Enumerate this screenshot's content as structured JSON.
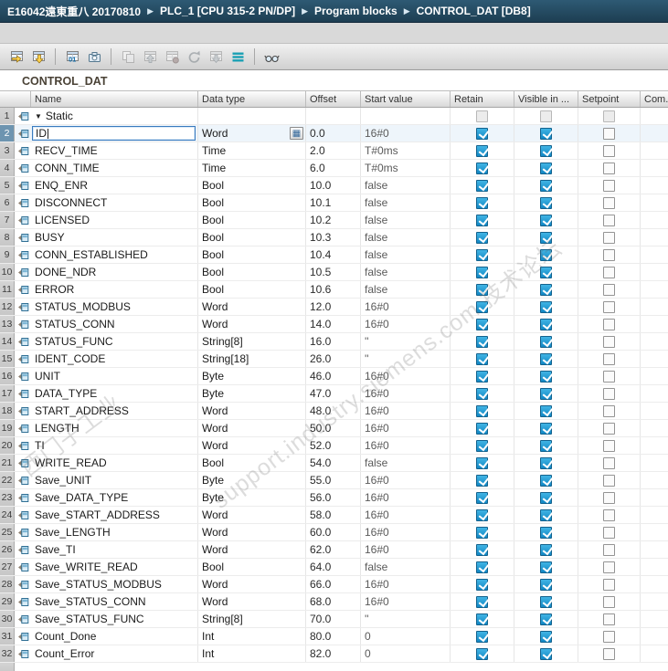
{
  "colors": {
    "titlebar": "#1d3e52",
    "checkbox_checked": "#1187c4",
    "selection": "#6d94b0",
    "toolbar_teal": "#19a0b4"
  },
  "breadcrumb": {
    "separator": "▶",
    "items": [
      "E16042遠東重八 20170810",
      "PLC_1 [CPU 315-2 PN/DP]",
      "Program blocks",
      "CONTROL_DAT [DB8]"
    ]
  },
  "toolbar": {
    "buttons": [
      {
        "name": "insert-row"
      },
      {
        "name": "add-row"
      },
      {
        "sep": true
      },
      {
        "name": "keep-actual-values"
      },
      {
        "name": "snapshot-actual-values"
      },
      {
        "sep": true
      },
      {
        "name": "copy-snapshots-to-start-values",
        "disabled": true
      },
      {
        "name": "load-start-values-as-actual",
        "disabled": true
      },
      {
        "name": "initialize-setpoints",
        "disabled": true
      },
      {
        "name": "update-interface",
        "disabled": true
      },
      {
        "name": "download-without-reinit",
        "disabled": true
      },
      {
        "name": "expanded-mode"
      },
      {
        "sep": true
      },
      {
        "name": "monitor-all"
      }
    ]
  },
  "title": "CONTROL_DAT",
  "icons": {
    "collapse": "▼",
    "datatype_picker": "▦"
  },
  "table": {
    "columns": [
      "Name",
      "Data type",
      "Offset",
      "Start value",
      "Retain",
      "Visible in ...",
      "Setpoint",
      "Com..."
    ],
    "rows": [
      {
        "num": "1",
        "kind": "section",
        "name": "Static"
      },
      {
        "num": "2",
        "name": "ID",
        "data_type": "Word",
        "offset": "0.0",
        "start_value": "16#0",
        "retain": true,
        "visible": true,
        "setpoint": false,
        "editing": true
      },
      {
        "num": "3",
        "name": "RECV_TIME",
        "data_type": "Time",
        "offset": "2.0",
        "start_value": "T#0ms",
        "retain": true,
        "visible": true,
        "setpoint": false
      },
      {
        "num": "4",
        "name": "CONN_TIME",
        "data_type": "Time",
        "offset": "6.0",
        "start_value": "T#0ms",
        "retain": true,
        "visible": true,
        "setpoint": false
      },
      {
        "num": "5",
        "name": "ENQ_ENR",
        "data_type": "Bool",
        "offset": "10.0",
        "start_value": "false",
        "retain": true,
        "visible": true,
        "setpoint": false
      },
      {
        "num": "6",
        "name": "DISCONNECT",
        "data_type": "Bool",
        "offset": "10.1",
        "start_value": "false",
        "retain": true,
        "visible": true,
        "setpoint": false
      },
      {
        "num": "7",
        "name": "LICENSED",
        "data_type": "Bool",
        "offset": "10.2",
        "start_value": "false",
        "retain": true,
        "visible": true,
        "setpoint": false
      },
      {
        "num": "8",
        "name": "BUSY",
        "data_type": "Bool",
        "offset": "10.3",
        "start_value": "false",
        "retain": true,
        "visible": true,
        "setpoint": false
      },
      {
        "num": "9",
        "name": "CONN_ESTABLISHED",
        "data_type": "Bool",
        "offset": "10.4",
        "start_value": "false",
        "retain": true,
        "visible": true,
        "setpoint": false
      },
      {
        "num": "10",
        "name": "DONE_NDR",
        "data_type": "Bool",
        "offset": "10.5",
        "start_value": "false",
        "retain": true,
        "visible": true,
        "setpoint": false
      },
      {
        "num": "11",
        "name": "ERROR",
        "data_type": "Bool",
        "offset": "10.6",
        "start_value": "false",
        "retain": true,
        "visible": true,
        "setpoint": false
      },
      {
        "num": "12",
        "name": "STATUS_MODBUS",
        "data_type": "Word",
        "offset": "12.0",
        "start_value": "16#0",
        "retain": true,
        "visible": true,
        "setpoint": false
      },
      {
        "num": "13",
        "name": "STATUS_CONN",
        "data_type": "Word",
        "offset": "14.0",
        "start_value": "16#0",
        "retain": true,
        "visible": true,
        "setpoint": false
      },
      {
        "num": "14",
        "name": "STATUS_FUNC",
        "data_type": "String[8]",
        "offset": "16.0",
        "start_value": "''",
        "retain": true,
        "visible": true,
        "setpoint": false
      },
      {
        "num": "15",
        "name": "IDENT_CODE",
        "data_type": "String[18]",
        "offset": "26.0",
        "start_value": "''",
        "retain": true,
        "visible": true,
        "setpoint": false
      },
      {
        "num": "16",
        "name": "UNIT",
        "data_type": "Byte",
        "offset": "46.0",
        "start_value": "16#0",
        "retain": true,
        "visible": true,
        "setpoint": false
      },
      {
        "num": "17",
        "name": "DATA_TYPE",
        "data_type": "Byte",
        "offset": "47.0",
        "start_value": "16#0",
        "retain": true,
        "visible": true,
        "setpoint": false
      },
      {
        "num": "18",
        "name": "START_ADDRESS",
        "data_type": "Word",
        "offset": "48.0",
        "start_value": "16#0",
        "retain": true,
        "visible": true,
        "setpoint": false
      },
      {
        "num": "19",
        "name": "LENGTH",
        "data_type": "Word",
        "offset": "50.0",
        "start_value": "16#0",
        "retain": true,
        "visible": true,
        "setpoint": false
      },
      {
        "num": "20",
        "name": "TI",
        "data_type": "Word",
        "offset": "52.0",
        "start_value": "16#0",
        "retain": true,
        "visible": true,
        "setpoint": false
      },
      {
        "num": "21",
        "name": "WRITE_READ",
        "data_type": "Bool",
        "offset": "54.0",
        "start_value": "false",
        "retain": true,
        "visible": true,
        "setpoint": false
      },
      {
        "num": "22",
        "name": "Save_UNIT",
        "data_type": "Byte",
        "offset": "55.0",
        "start_value": "16#0",
        "retain": true,
        "visible": true,
        "setpoint": false
      },
      {
        "num": "23",
        "name": "Save_DATA_TYPE",
        "data_type": "Byte",
        "offset": "56.0",
        "start_value": "16#0",
        "retain": true,
        "visible": true,
        "setpoint": false
      },
      {
        "num": "24",
        "name": "Save_START_ADDRESS",
        "data_type": "Word",
        "offset": "58.0",
        "start_value": "16#0",
        "retain": true,
        "visible": true,
        "setpoint": false
      },
      {
        "num": "25",
        "name": "Save_LENGTH",
        "data_type": "Word",
        "offset": "60.0",
        "start_value": "16#0",
        "retain": true,
        "visible": true,
        "setpoint": false
      },
      {
        "num": "26",
        "name": "Save_TI",
        "data_type": "Word",
        "offset": "62.0",
        "start_value": "16#0",
        "retain": true,
        "visible": true,
        "setpoint": false
      },
      {
        "num": "27",
        "name": "Save_WRITE_READ",
        "data_type": "Bool",
        "offset": "64.0",
        "start_value": "false",
        "retain": true,
        "visible": true,
        "setpoint": false
      },
      {
        "num": "28",
        "name": "Save_STATUS_MODBUS",
        "data_type": "Word",
        "offset": "66.0",
        "start_value": "16#0",
        "retain": true,
        "visible": true,
        "setpoint": false
      },
      {
        "num": "29",
        "name": "Save_STATUS_CONN",
        "data_type": "Word",
        "offset": "68.0",
        "start_value": "16#0",
        "retain": true,
        "visible": true,
        "setpoint": false
      },
      {
        "num": "30",
        "name": "Save_STATUS_FUNC",
        "data_type": "String[8]",
        "offset": "70.0",
        "start_value": "''",
        "retain": true,
        "visible": true,
        "setpoint": false
      },
      {
        "num": "31",
        "name": "Count_Done",
        "data_type": "Int",
        "offset": "80.0",
        "start_value": "0",
        "retain": true,
        "visible": true,
        "setpoint": false
      },
      {
        "num": "32",
        "name": "Count_Error",
        "data_type": "Int",
        "offset": "82.0",
        "start_value": "0",
        "retain": true,
        "visible": true,
        "setpoint": false
      }
    ]
  },
  "watermark": {
    "lines": [
      "西门子工业",
      "support.industry.siemens.com 技术论坛"
    ]
  }
}
